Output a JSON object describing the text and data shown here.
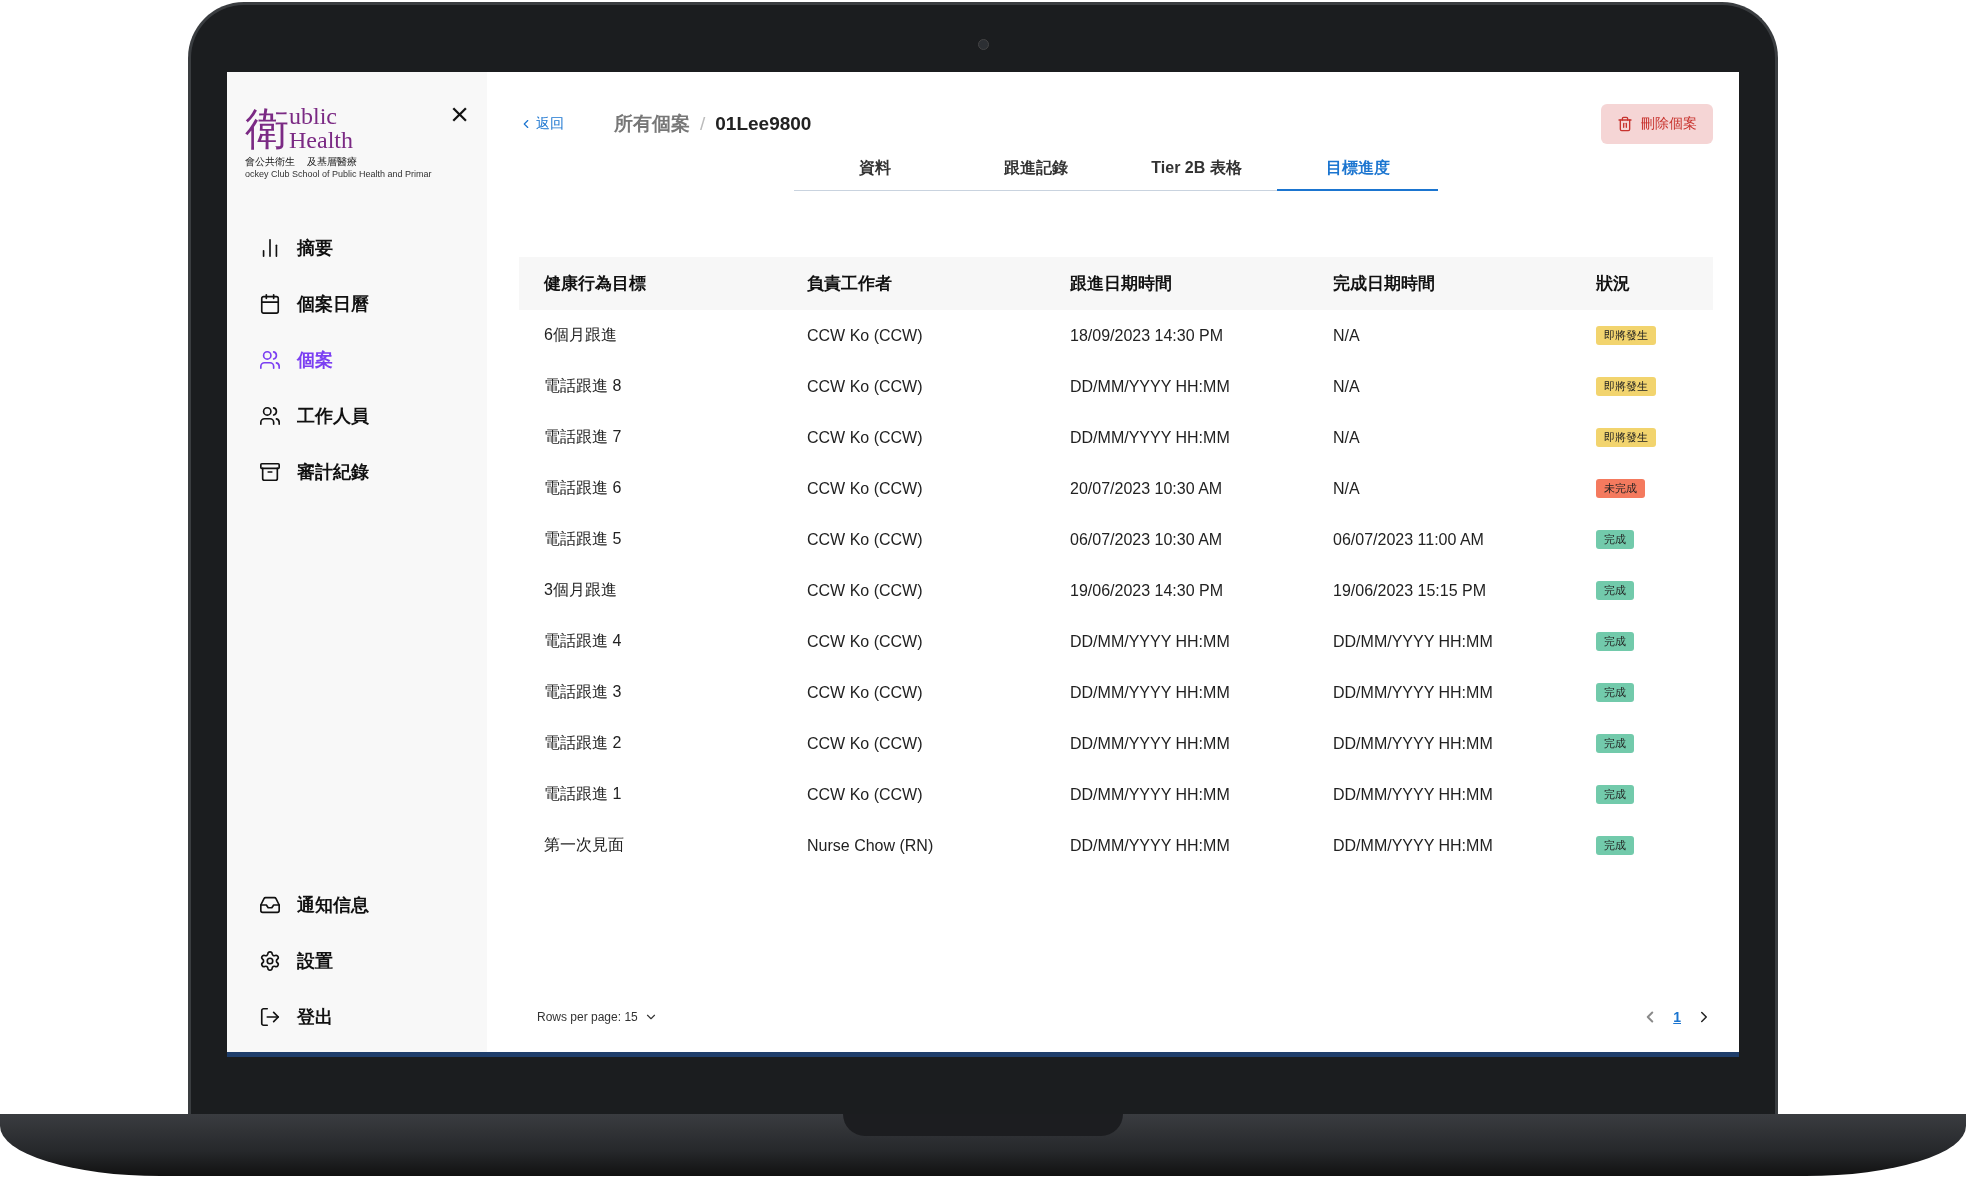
{
  "logo": {
    "glyph": "衛",
    "line_1": "ublic",
    "line_2": "ealth",
    "letter": "H",
    "chinese_left": "會公共衛生",
    "chinese_right": "及基層醫療",
    "english": "ockey Club School of Public Health and Primar"
  },
  "close_button": "×",
  "sidebar": {
    "items": [
      {
        "label": "摘要",
        "selected": false
      },
      {
        "label": "個案日曆",
        "selected": false
      },
      {
        "label": "個案",
        "selected": true
      },
      {
        "label": "工作人員",
        "selected": false
      },
      {
        "label": "審計紀錄",
        "selected": false
      }
    ],
    "bottom_items": [
      {
        "label": "通知信息"
      },
      {
        "label": "設置"
      },
      {
        "label": "登出"
      }
    ]
  },
  "header": {
    "back": "返回",
    "breadcrumb": [
      "所有個案",
      "01Lee9800"
    ],
    "separator": "/",
    "delete_button": "刪除個案"
  },
  "tabs": [
    {
      "label": "資料",
      "selected": false
    },
    {
      "label": "跟進記錄",
      "selected": false
    },
    {
      "label": "Tier 2B 表格",
      "selected": false
    },
    {
      "label": "目標進度",
      "selected": true
    }
  ],
  "table": {
    "columns": [
      "健康行為目標",
      "負責工作者",
      "跟進日期時間",
      "完成日期時間",
      "狀況"
    ],
    "rows": [
      {
        "goal": "6個月跟進",
        "worker": "CCW Ko (CCW)",
        "follow_up": "18/09/2023 14:30 PM",
        "completed": "N/A",
        "status": "即將發生",
        "kind": "upcoming"
      },
      {
        "goal": "電話跟進 8",
        "worker": "CCW Ko (CCW)",
        "follow_up": "DD/MM/YYYY HH:MM",
        "completed": "N/A",
        "status": "即將發生",
        "kind": "upcoming"
      },
      {
        "goal": "電話跟進 7",
        "worker": "CCW Ko (CCW)",
        "follow_up": "DD/MM/YYYY HH:MM",
        "completed": "N/A",
        "status": "即將發生",
        "kind": "upcoming"
      },
      {
        "goal": "電話跟進 6",
        "worker": "CCW Ko (CCW)",
        "follow_up": "20/07/2023 10:30 AM",
        "completed": "N/A",
        "status": "未完成",
        "kind": "incomplete"
      },
      {
        "goal": "電話跟進 5",
        "worker": "CCW Ko (CCW)",
        "follow_up": "06/07/2023 10:30 AM",
        "completed": "06/07/2023 11:00 AM",
        "status": "完成",
        "kind": "done"
      },
      {
        "goal": "3個月跟進",
        "worker": "CCW Ko (CCW)",
        "follow_up": "19/06/2023 14:30 PM",
        "completed": "19/06/2023 15:15 PM",
        "status": "完成",
        "kind": "done"
      },
      {
        "goal": "電話跟進 4",
        "worker": "CCW Ko (CCW)",
        "follow_up": "DD/MM/YYYY HH:MM",
        "completed": "DD/MM/YYYY HH:MM",
        "status": "完成",
        "kind": "done"
      },
      {
        "goal": "電話跟進 3",
        "worker": "CCW Ko (CCW)",
        "follow_up": "DD/MM/YYYY HH:MM",
        "completed": "DD/MM/YYYY HH:MM",
        "status": "完成",
        "kind": "done"
      },
      {
        "goal": "電話跟進 2",
        "worker": "CCW Ko (CCW)",
        "follow_up": "DD/MM/YYYY HH:MM",
        "completed": "DD/MM/YYYY HH:MM",
        "status": "完成",
        "kind": "done"
      },
      {
        "goal": "電話跟進 1",
        "worker": "CCW Ko (CCW)",
        "follow_up": "DD/MM/YYYY HH:MM",
        "completed": "DD/MM/YYYY HH:MM",
        "status": "完成",
        "kind": "done"
      },
      {
        "goal": "第一次見面",
        "worker": "Nurse Chow (RN)",
        "follow_up": "DD/MM/YYYY HH:MM",
        "completed": "DD/MM/YYYY HH:MM",
        "status": "完成",
        "kind": "done"
      }
    ]
  },
  "pagination": {
    "rows_per_page": "Rows per page: 15",
    "pages": [
      {
        "label": "1",
        "selected": true
      }
    ]
  }
}
